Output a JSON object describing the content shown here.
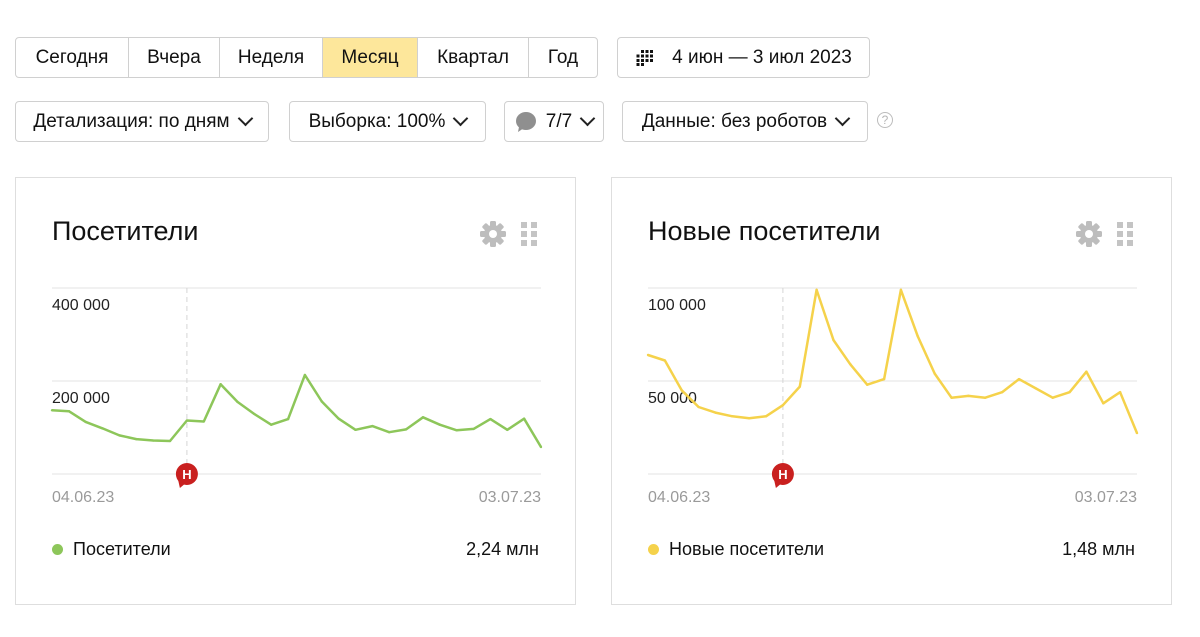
{
  "periods": [
    "Сегодня",
    "Вчера",
    "Неделя",
    "Месяц",
    "Квартал",
    "Год"
  ],
  "active_period": "Месяц",
  "date_range": "4 июн — 3 июл 2023",
  "filters": {
    "detail": "Детализация: по дням",
    "sample": "Выборка: 100%",
    "segments": "7/7",
    "data": "Данные: без роботов",
    "help": "?"
  },
  "annotation_marker": "Н",
  "accent_colors": {
    "active_period_bg": "#fde79b",
    "visitors": "#8dc65a",
    "new_visitors": "#f5d24b",
    "marker": "#c9201f"
  },
  "widgets": [
    {
      "title": "Посетители",
      "legend_label": "Посетители",
      "legend_value": "2,24 млн",
      "chart_data": {
        "type": "line",
        "x_start_label": "04.06.23",
        "x_end_label": "03.07.23",
        "y_ticks": [
          "400 000",
          "200 000"
        ],
        "ylim": [
          0,
          400000
        ],
        "annotation_index": 8,
        "series": [
          {
            "color": "#8dc65a",
            "values": [
              137000,
              135000,
              112000,
              98000,
              83000,
              75000,
              72000,
              71000,
              115000,
              113000,
              193000,
              155000,
              129000,
              106000,
              118000,
              213000,
              156000,
              119000,
              95000,
              103000,
              90000,
              96000,
              122000,
              106000,
              94000,
              97000,
              118000,
              95000,
              119000,
              58000
            ]
          }
        ]
      }
    },
    {
      "title": "Новые посетители",
      "legend_label": "Новые посетители",
      "legend_value": "1,48 млн",
      "chart_data": {
        "type": "line",
        "x_start_label": "04.06.23",
        "x_end_label": "03.07.23",
        "y_ticks": [
          "100 000",
          "50 000"
        ],
        "ylim": [
          0,
          100000
        ],
        "annotation_index": 8,
        "series": [
          {
            "color": "#f5d24b",
            "values": [
              64000,
              61000,
              45000,
              36000,
              33000,
              31000,
              30000,
              31000,
              37000,
              47000,
              99000,
              72000,
              59000,
              48000,
              51000,
              99000,
              74000,
              54000,
              41000,
              42000,
              41000,
              44000,
              51000,
              46000,
              41000,
              44000,
              55000,
              38000,
              44000,
              22000
            ]
          }
        ]
      }
    }
  ]
}
